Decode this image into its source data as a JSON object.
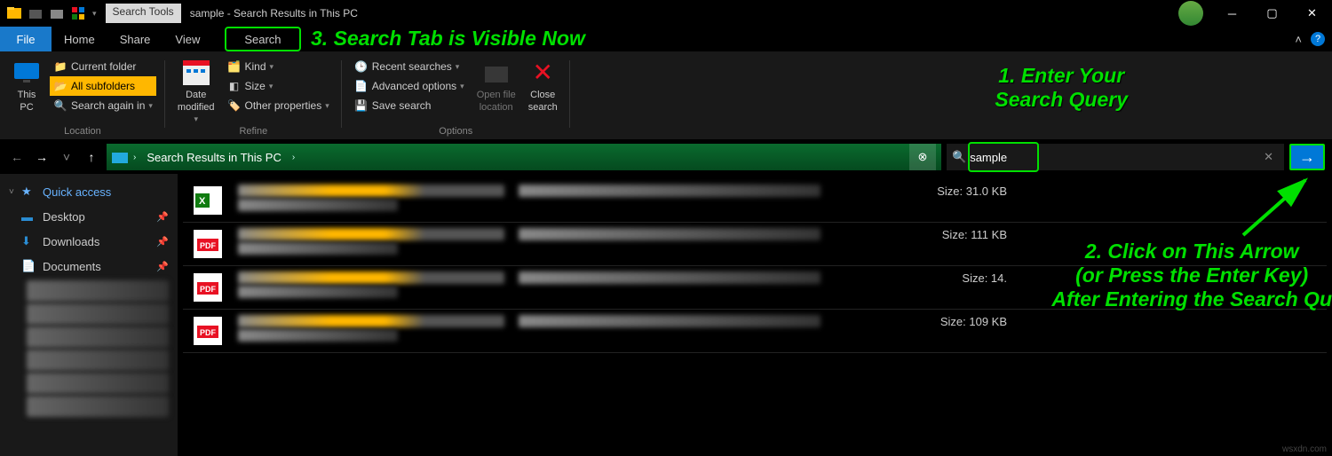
{
  "titlebar": {
    "search_tools_label": "Search Tools",
    "window_title": "sample - Search Results in This PC"
  },
  "menu": {
    "file": "File",
    "home": "Home",
    "share": "Share",
    "view": "View",
    "search": "Search"
  },
  "ribbon": {
    "this_pc": "This\nPC",
    "current_folder": "Current folder",
    "all_subfolders": "All subfolders",
    "search_again_in": "Search again in",
    "location_group": "Location",
    "date_modified": "Date\nmodified",
    "kind": "Kind",
    "size": "Size",
    "other_properties": "Other properties",
    "refine_group": "Refine",
    "recent_searches": "Recent searches",
    "advanced_options": "Advanced options",
    "save_search": "Save search",
    "open_file_location": "Open file\nlocation",
    "close_search": "Close\nsearch",
    "options_group": "Options"
  },
  "address": {
    "crumb": "Search Results in This PC"
  },
  "search": {
    "value": "sample"
  },
  "sidebar": {
    "quick_access": "Quick access",
    "desktop": "Desktop",
    "downloads": "Downloads",
    "documents": "Documents"
  },
  "results": [
    {
      "size": "Size: 31.0 KB",
      "type": "xlsx"
    },
    {
      "size": "Size: 111 KB",
      "type": "pdf"
    },
    {
      "size": "Size: 14.",
      "type": "pdf"
    },
    {
      "size": "Size: 109 KB",
      "type": "pdf"
    }
  ],
  "annotations": {
    "a1": "1. Enter Your\nSearch Query",
    "a2": "2. Click on This Arrow\n(or Press the Enter Key)\nAfter Entering the Search Qu",
    "a3": "3. Search Tab is Visible Now"
  },
  "watermark": "wsxdn.com"
}
